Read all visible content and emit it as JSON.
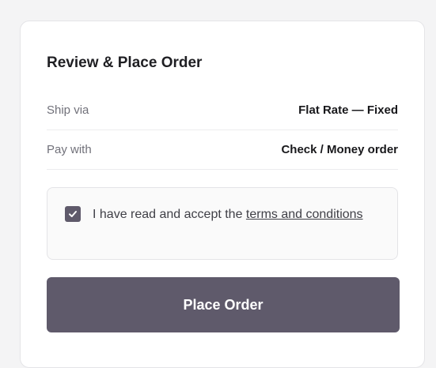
{
  "review": {
    "title": "Review & Place Order",
    "shipping": {
      "label": "Ship via",
      "value": "Flat Rate — Fixed"
    },
    "payment": {
      "label": "Pay with",
      "value": "Check / Money order"
    }
  },
  "terms": {
    "checked": true,
    "text_prefix": "I have read and accept the ",
    "link_text": "terms and conditions"
  },
  "actions": {
    "place_order_label": "Place Order"
  },
  "colors": {
    "accent": "#5f5a6b",
    "card_border": "#e4e4e7",
    "background": "#f4f4f5"
  }
}
